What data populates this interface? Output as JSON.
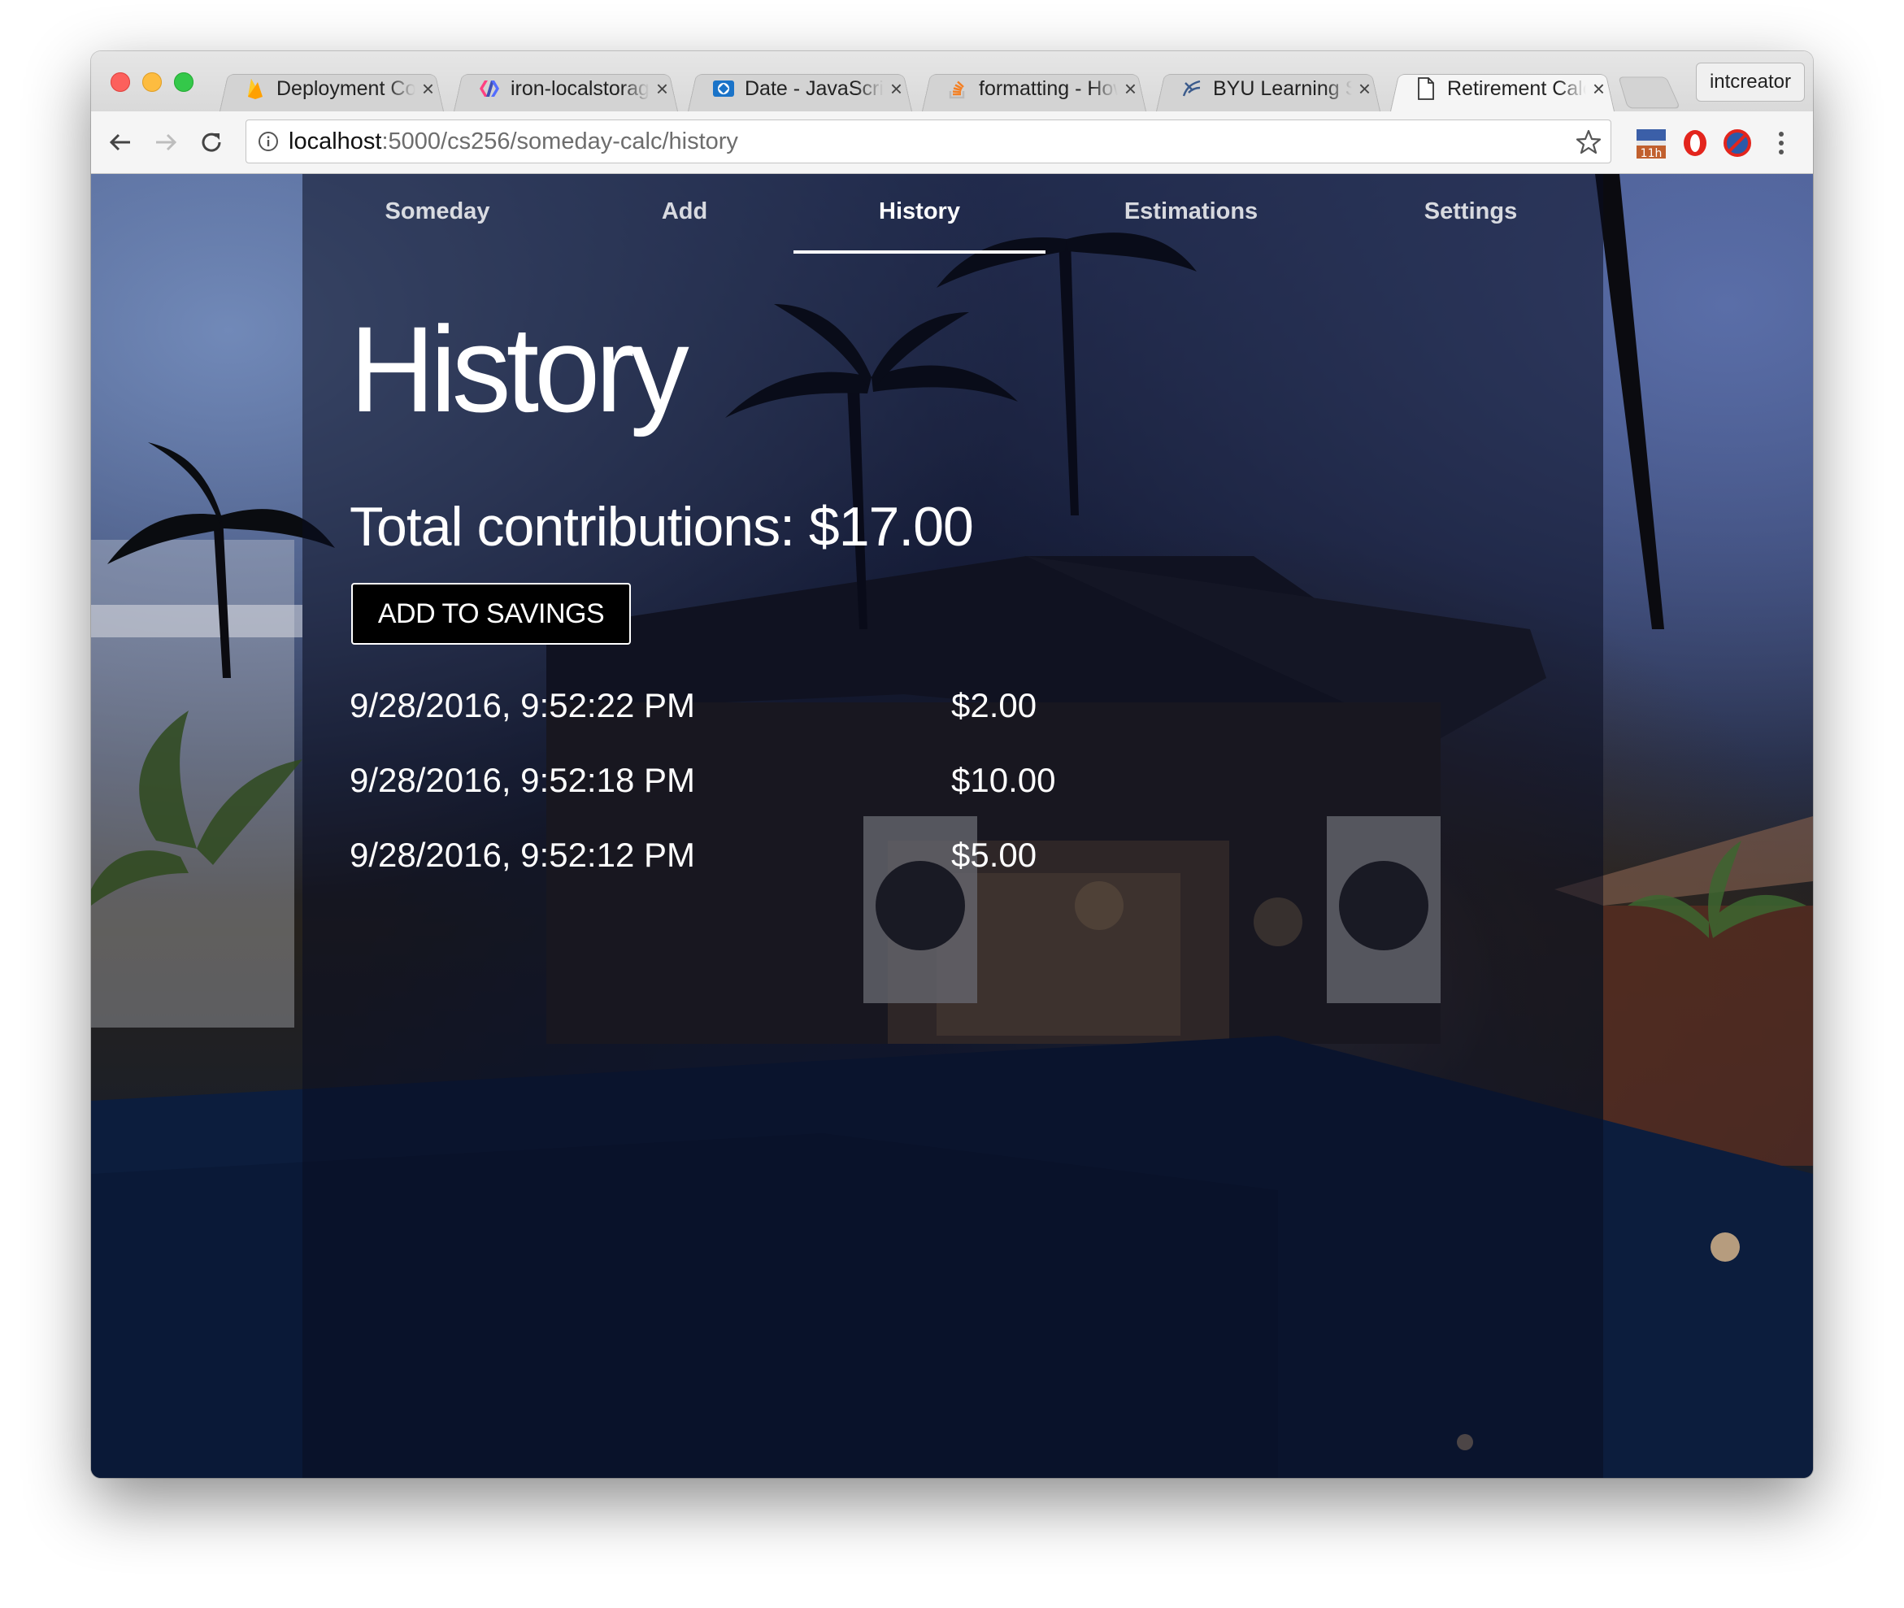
{
  "browser": {
    "tabs": [
      {
        "title": "Deployment Con",
        "icon": "firebase-icon",
        "active": false
      },
      {
        "title": "iron-localstorage",
        "icon": "polymer-icon",
        "active": false
      },
      {
        "title": "Date - JavaScript",
        "icon": "mdn-icon",
        "active": false
      },
      {
        "title": "formatting - How",
        "icon": "stackoverflow-icon",
        "active": false
      },
      {
        "title": "BYU Learning Suite",
        "icon": "byu-icon",
        "active": false
      },
      {
        "title": "Retirement Calc",
        "icon": "page-icon",
        "active": true
      }
    ],
    "close_glyph": "×",
    "profile_name": "intcreator",
    "url_host": "localhost",
    "url_rest": ":5000/cs256/someday-calc/history",
    "extension_badge": "11h"
  },
  "app": {
    "nav": [
      {
        "label": "Someday",
        "active": false
      },
      {
        "label": "Add",
        "active": false
      },
      {
        "label": "History",
        "active": true
      },
      {
        "label": "Estimations",
        "active": false
      },
      {
        "label": "Settings",
        "active": false
      }
    ],
    "page_title": "History",
    "total_label": "Total contributions: $17.00",
    "add_button_label": "ADD TO SAVINGS",
    "history": [
      {
        "date": "9/28/2016, 9:52:22 PM",
        "amount": "$2.00"
      },
      {
        "date": "9/28/2016, 9:52:18 PM",
        "amount": "$10.00"
      },
      {
        "date": "9/28/2016, 9:52:12 PM",
        "amount": "$5.00"
      }
    ]
  },
  "colors": {
    "panel_overlay": "#0a0c20",
    "text": "#ffffff",
    "button_bg": "#000000"
  }
}
